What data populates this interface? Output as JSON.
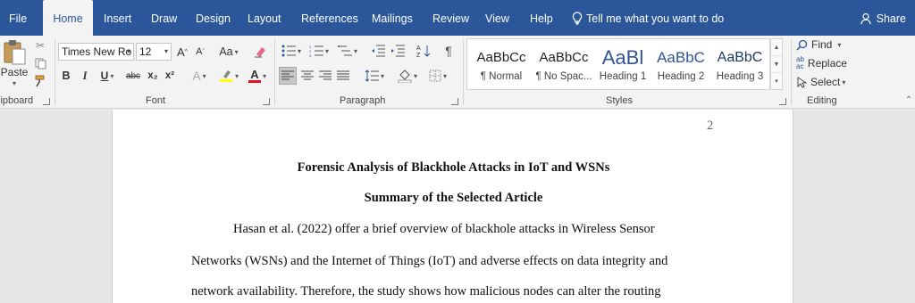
{
  "tabs": [
    "File",
    "Home",
    "Insert",
    "Draw",
    "Design",
    "Layout",
    "References",
    "Mailings",
    "Review",
    "View",
    "Help"
  ],
  "tell_me": "Tell me what you want to do",
  "share": "Share",
  "clipboard": {
    "paste": "Paste",
    "label": "lipboard"
  },
  "font": {
    "name": "Times New Ro",
    "size": "12",
    "grow": "A",
    "shrink": "A",
    "change_case": "Aa",
    "bold": "B",
    "italic": "I",
    "underline": "U",
    "strike": "abc",
    "subscript": "x₂",
    "superscript": "x²",
    "effects": "A",
    "font_color": "A",
    "label": "Font"
  },
  "paragraph": {
    "label": "Paragraph"
  },
  "styles": {
    "items": [
      {
        "sample": "AaBbCc",
        "name": "¶ Normal"
      },
      {
        "sample": "AaBbCc",
        "name": "¶ No Spac..."
      },
      {
        "sample": "AaBl",
        "name": "Heading 1"
      },
      {
        "sample": "AaBbC",
        "name": "Heading 2"
      },
      {
        "sample": "AaBbC",
        "name": "Heading 3"
      }
    ],
    "label": "Styles"
  },
  "editing": {
    "find": "Find",
    "replace": "Replace",
    "select": "Select",
    "label": "Editing"
  },
  "document": {
    "page_number": "2",
    "title": "Forensic Analysis of Blackhole Attacks in IoT and WSNs",
    "subtitle": "Summary of the Selected Article",
    "lines": [
      "Hasan et al. (2022) offer a brief overview of blackhole attacks in Wireless Sensor",
      "Networks (WSNs) and the Internet of Things (IoT) and adverse effects on data integrity and",
      "network availability. Therefore, the study shows how malicious nodes can alter the routing"
    ]
  },
  "colors": {
    "accent": "#2b579a",
    "ribbon": "#f3f3f3",
    "highlight": "#ffff00",
    "font_color": "#e81123",
    "heading": "#2f5496"
  }
}
